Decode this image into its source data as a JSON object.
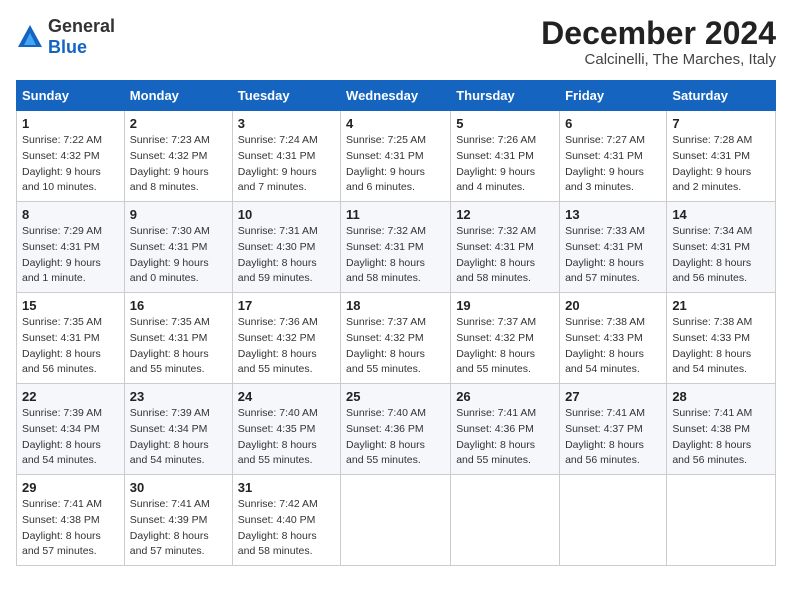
{
  "logo": {
    "text_general": "General",
    "text_blue": "Blue"
  },
  "header": {
    "month_title": "December 2024",
    "location": "Calcinelli, The Marches, Italy"
  },
  "calendar": {
    "days_of_week": [
      "Sunday",
      "Monday",
      "Tuesday",
      "Wednesday",
      "Thursday",
      "Friday",
      "Saturday"
    ],
    "weeks": [
      [
        {
          "day": "1",
          "sunrise": "7:22 AM",
          "sunset": "4:32 PM",
          "daylight": "9 hours and 10 minutes."
        },
        {
          "day": "2",
          "sunrise": "7:23 AM",
          "sunset": "4:32 PM",
          "daylight": "9 hours and 8 minutes."
        },
        {
          "day": "3",
          "sunrise": "7:24 AM",
          "sunset": "4:31 PM",
          "daylight": "9 hours and 7 minutes."
        },
        {
          "day": "4",
          "sunrise": "7:25 AM",
          "sunset": "4:31 PM",
          "daylight": "9 hours and 6 minutes."
        },
        {
          "day": "5",
          "sunrise": "7:26 AM",
          "sunset": "4:31 PM",
          "daylight": "9 hours and 4 minutes."
        },
        {
          "day": "6",
          "sunrise": "7:27 AM",
          "sunset": "4:31 PM",
          "daylight": "9 hours and 3 minutes."
        },
        {
          "day": "7",
          "sunrise": "7:28 AM",
          "sunset": "4:31 PM",
          "daylight": "9 hours and 2 minutes."
        }
      ],
      [
        {
          "day": "8",
          "sunrise": "7:29 AM",
          "sunset": "4:31 PM",
          "daylight": "9 hours and 1 minute."
        },
        {
          "day": "9",
          "sunrise": "7:30 AM",
          "sunset": "4:31 PM",
          "daylight": "9 hours and 0 minutes."
        },
        {
          "day": "10",
          "sunrise": "7:31 AM",
          "sunset": "4:30 PM",
          "daylight": "8 hours and 59 minutes."
        },
        {
          "day": "11",
          "sunrise": "7:32 AM",
          "sunset": "4:31 PM",
          "daylight": "8 hours and 58 minutes."
        },
        {
          "day": "12",
          "sunrise": "7:32 AM",
          "sunset": "4:31 PM",
          "daylight": "8 hours and 58 minutes."
        },
        {
          "day": "13",
          "sunrise": "7:33 AM",
          "sunset": "4:31 PM",
          "daylight": "8 hours and 57 minutes."
        },
        {
          "day": "14",
          "sunrise": "7:34 AM",
          "sunset": "4:31 PM",
          "daylight": "8 hours and 56 minutes."
        }
      ],
      [
        {
          "day": "15",
          "sunrise": "7:35 AM",
          "sunset": "4:31 PM",
          "daylight": "8 hours and 56 minutes."
        },
        {
          "day": "16",
          "sunrise": "7:35 AM",
          "sunset": "4:31 PM",
          "daylight": "8 hours and 55 minutes."
        },
        {
          "day": "17",
          "sunrise": "7:36 AM",
          "sunset": "4:32 PM",
          "daylight": "8 hours and 55 minutes."
        },
        {
          "day": "18",
          "sunrise": "7:37 AM",
          "sunset": "4:32 PM",
          "daylight": "8 hours and 55 minutes."
        },
        {
          "day": "19",
          "sunrise": "7:37 AM",
          "sunset": "4:32 PM",
          "daylight": "8 hours and 55 minutes."
        },
        {
          "day": "20",
          "sunrise": "7:38 AM",
          "sunset": "4:33 PM",
          "daylight": "8 hours and 54 minutes."
        },
        {
          "day": "21",
          "sunrise": "7:38 AM",
          "sunset": "4:33 PM",
          "daylight": "8 hours and 54 minutes."
        }
      ],
      [
        {
          "day": "22",
          "sunrise": "7:39 AM",
          "sunset": "4:34 PM",
          "daylight": "8 hours and 54 minutes."
        },
        {
          "day": "23",
          "sunrise": "7:39 AM",
          "sunset": "4:34 PM",
          "daylight": "8 hours and 54 minutes."
        },
        {
          "day": "24",
          "sunrise": "7:40 AM",
          "sunset": "4:35 PM",
          "daylight": "8 hours and 55 minutes."
        },
        {
          "day": "25",
          "sunrise": "7:40 AM",
          "sunset": "4:36 PM",
          "daylight": "8 hours and 55 minutes."
        },
        {
          "day": "26",
          "sunrise": "7:41 AM",
          "sunset": "4:36 PM",
          "daylight": "8 hours and 55 minutes."
        },
        {
          "day": "27",
          "sunrise": "7:41 AM",
          "sunset": "4:37 PM",
          "daylight": "8 hours and 56 minutes."
        },
        {
          "day": "28",
          "sunrise": "7:41 AM",
          "sunset": "4:38 PM",
          "daylight": "8 hours and 56 minutes."
        }
      ],
      [
        {
          "day": "29",
          "sunrise": "7:41 AM",
          "sunset": "4:38 PM",
          "daylight": "8 hours and 57 minutes."
        },
        {
          "day": "30",
          "sunrise": "7:41 AM",
          "sunset": "4:39 PM",
          "daylight": "8 hours and 57 minutes."
        },
        {
          "day": "31",
          "sunrise": "7:42 AM",
          "sunset": "4:40 PM",
          "daylight": "8 hours and 58 minutes."
        },
        null,
        null,
        null,
        null
      ]
    ]
  }
}
